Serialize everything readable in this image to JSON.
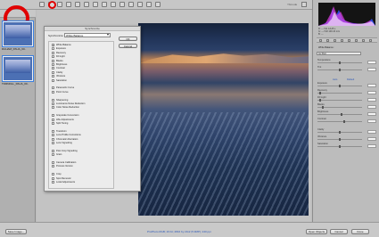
{
  "toolbar": {
    "tools": [
      "zoom-icon",
      "hand-icon",
      "white-balance-icon",
      "color-sampler-icon",
      "target-adjust-icon",
      "crop-icon",
      "straighten-icon",
      "spot-removal-icon",
      "red-eye-icon",
      "adjustment-brush-icon",
      "graduated-filter-icon",
      "preferences-icon",
      "rotate-left-icon",
      "rotate-right-icon"
    ],
    "fullscreen_label": "Ybmode"
  },
  "filmstrip": {
    "header_label": "",
    "items": [
      {
        "name": "DUHAM_PAUA_00..",
        "selected": true
      },
      {
        "name": "TORNDLL_PAUA_00..",
        "selected": true
      }
    ]
  },
  "dialog": {
    "title": "Synchronize",
    "sync_label": "Synchronize:",
    "sync_value": "White Balance",
    "ok_label": "OK",
    "cancel_label": "Cancel",
    "options": [
      {
        "label": "White Balance",
        "checked": true,
        "indent": false
      },
      {
        "label": "Exposure",
        "checked": false,
        "indent": false
      },
      {
        "label": "Recovery",
        "checked": false,
        "indent": false
      },
      {
        "label": "Fill Light",
        "checked": false,
        "indent": false
      },
      {
        "label": "Blacks",
        "checked": false,
        "indent": false
      },
      {
        "label": "Brightness",
        "checked": false,
        "indent": false
      },
      {
        "label": "Contrast",
        "checked": false,
        "indent": false
      },
      {
        "label": "Clarity",
        "checked": false,
        "indent": false
      },
      {
        "label": "Vibrance",
        "checked": false,
        "indent": false
      },
      {
        "label": "Saturation",
        "checked": false,
        "indent": false
      },
      {
        "label": "",
        "checked": null,
        "indent": false
      },
      {
        "label": "Parametric Curve",
        "checked": false,
        "indent": false
      },
      {
        "label": "Point Curve",
        "checked": false,
        "indent": false
      },
      {
        "label": "",
        "checked": null,
        "indent": false
      },
      {
        "label": "Sharpening",
        "checked": false,
        "indent": false
      },
      {
        "label": "Luminance Noise Reduction",
        "checked": false,
        "indent": false
      },
      {
        "label": "Color Noise Reduction",
        "checked": false,
        "indent": false
      },
      {
        "label": "",
        "checked": null,
        "indent": false
      },
      {
        "label": "Grayscale Conversion",
        "checked": false,
        "indent": false
      },
      {
        "label": "HSL Adjustments",
        "checked": false,
        "indent": false
      },
      {
        "label": "Split Toning",
        "checked": false,
        "indent": false
      },
      {
        "label": "",
        "checked": null,
        "indent": false
      },
      {
        "label": "Transform",
        "checked": false,
        "indent": false
      },
      {
        "label": "Lens Profile Corrections",
        "checked": false,
        "indent": false
      },
      {
        "label": "Chromatic Aberration",
        "checked": false,
        "indent": false
      },
      {
        "label": "Lens Vignetting",
        "checked": false,
        "indent": false
      },
      {
        "label": "",
        "checked": null,
        "indent": false
      },
      {
        "label": "Post Crop Vignetting",
        "checked": false,
        "indent": false
      },
      {
        "label": "Grain",
        "checked": false,
        "indent": false
      },
      {
        "label": "",
        "checked": null,
        "indent": false
      },
      {
        "label": "Camera Calibration",
        "checked": false,
        "indent": false
      },
      {
        "label": "Process Version",
        "checked": false,
        "indent": false
      },
      {
        "label": "",
        "checked": null,
        "indent": false
      },
      {
        "label": "Crop",
        "checked": false,
        "indent": false
      },
      {
        "label": "Spot Removal",
        "checked": false,
        "indent": false
      },
      {
        "label": "Local Adjustments",
        "checked": false,
        "indent": false
      }
    ]
  },
  "right_panel": {
    "readout": [
      "R:  ---   f/11  1/125 s",
      "G:  ---   ISO 100  24 mm",
      "B:  ---"
    ],
    "white_balance_label": "White Balance:",
    "white_balance_value": "As Shot",
    "sliders": [
      {
        "label": "Temperature",
        "value": 0.5
      },
      {
        "label": "Tint",
        "value": 0.5
      },
      {
        "label": "",
        "value": null
      },
      {
        "label": "Exposure",
        "value": 0.5
      },
      {
        "label": "Recovery",
        "value": 0.05
      },
      {
        "label": "Fill Light",
        "value": 0.05
      },
      {
        "label": "Blacks",
        "value": 0.1
      },
      {
        "label": "Brightness",
        "value": 0.55
      },
      {
        "label": "Contrast",
        "value": 0.6
      },
      {
        "label": "",
        "value": null
      },
      {
        "label": "Clarity",
        "value": 0.5
      },
      {
        "label": "Vibrance",
        "value": 0.5
      },
      {
        "label": "Saturation",
        "value": 0.5
      }
    ],
    "auto_label": "Auto",
    "default_label": "Default"
  },
  "bottom": {
    "zoom": "",
    "save_label": "Save Image...",
    "workflow": "ProPhoto RGB; 16 bit; 2816 by 2112 (5.9MP); 240 ppi",
    "open_label": "Open Objects",
    "cancel_label": "Cancel",
    "done_label": "Done"
  },
  "colors": {
    "highlight_circle": "#e00000",
    "workflow_link": "#2a56b8"
  }
}
